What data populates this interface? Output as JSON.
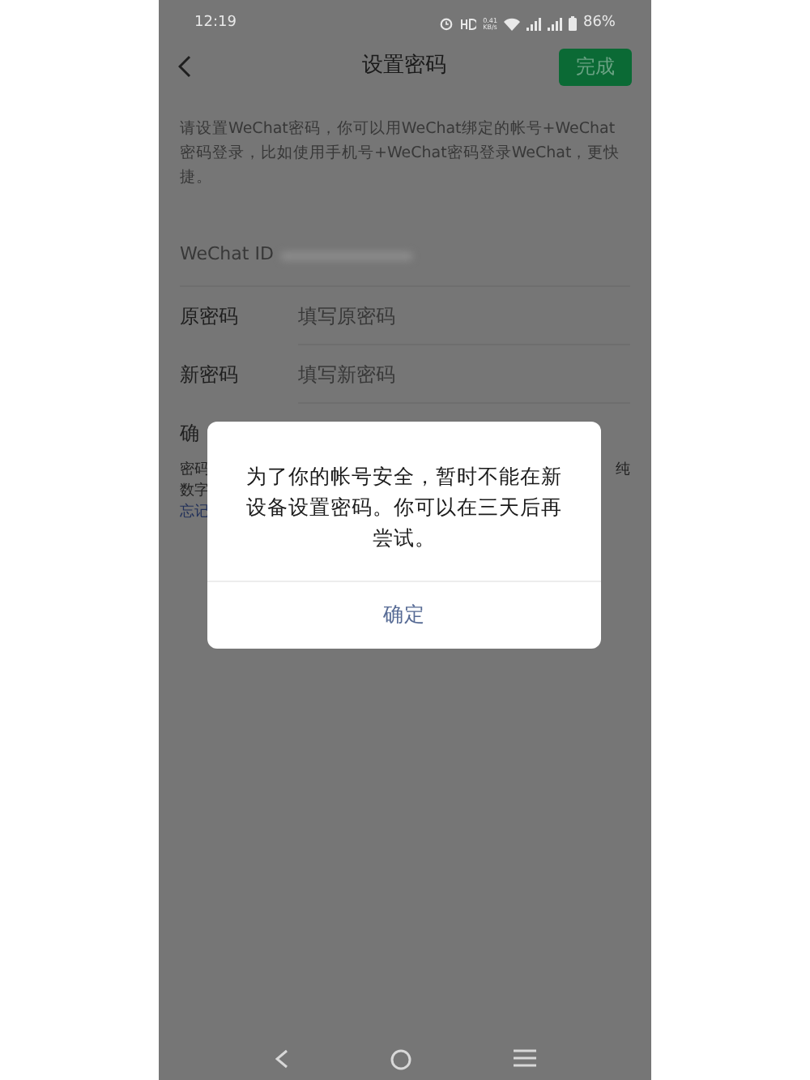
{
  "status_bar": {
    "time": "12:19",
    "net_speed": [
      "0.41",
      "KB/s"
    ],
    "battery": "86%"
  },
  "nav": {
    "title": "设置密码",
    "done": "完成"
  },
  "intro": "请设置WeChat密码，你可以用WeChat绑定的帐号+WeChat密码登录，比如使用手机号+WeChat密码登录WeChat，更快捷。",
  "wechat_id": {
    "label": "WeChat ID"
  },
  "fields": [
    {
      "label": "原密码",
      "placeholder": "填写原密码"
    },
    {
      "label": "新密码",
      "placeholder": "填写新密码"
    }
  ],
  "confirm_label": "确",
  "note_fragments": {
    "left": [
      "密码",
      "数字",
      "忘记"
    ],
    "right": "纯"
  },
  "dialog": {
    "message": "为了你的帐号安全，暂时不能在新设备设置密码。你可以在三天后再尝试。",
    "button": "确定"
  }
}
